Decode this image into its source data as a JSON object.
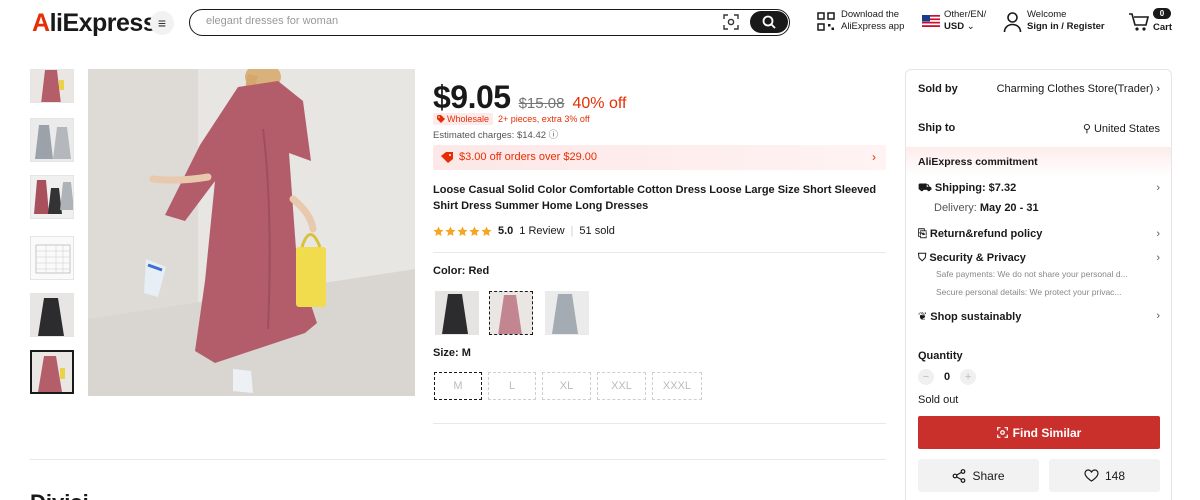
{
  "header": {
    "logo_part1": "A",
    "logo_part2": "liExpress",
    "search_placeholder": "elegant dresses for woman",
    "app_line1": "Download the",
    "app_line2": "AliExpress app",
    "locale_line1": "Other/EN/",
    "locale_line2": "USD",
    "user_line1": "Welcome",
    "user_line2": "Sign in / Register",
    "cart_count": "0",
    "cart_label": "Cart"
  },
  "product": {
    "price": "$9.05",
    "original_price": "$15.08",
    "discount": "40% off",
    "wholesale_badge": "Wholesale",
    "wholesale_text": "2+ pieces, extra 3% off",
    "estimated": "Estimated charges: $14.42",
    "coupon": "$3.00 off orders over $29.00",
    "title": "Loose Casual Solid Color Comfortable Cotton Dress Loose Large Size Short Sleeved Shirt Dress Summer Home Long Dresses",
    "rating": 5.0,
    "rating_text": "5.0",
    "reviews": "1 Review",
    "sold": "51 sold",
    "color_label": "Color: Red",
    "size_label": "Size: M",
    "sizes": [
      "M",
      "L",
      "XL",
      "XXL",
      "XXXL"
    ],
    "selected_size": "M",
    "colors": [
      "Black",
      "Red",
      "Gray"
    ],
    "selected_color": "Red"
  },
  "panel": {
    "sold_by_label": "Sold by",
    "sold_by_value": "Charming Clothes Store(Trader)",
    "ship_to_label": "Ship to",
    "ship_to_value": "United States",
    "commitment": "AliExpress commitment",
    "shipping": "Shipping: $7.32",
    "delivery_label": "Delivery:",
    "delivery_value": "May 20 - 31",
    "return_policy": "Return&refund policy",
    "security": "Security & Privacy",
    "security_line1": "Safe payments: We do not share your personal d...",
    "security_line2": "Secure personal details: We protect your privac...",
    "sustainably": "Shop sustainably",
    "quantity_label": "Quantity",
    "quantity_value": "0",
    "sold_out": "Sold out",
    "find_similar": "Find Similar",
    "share": "Share",
    "likes": "148"
  },
  "bottom": {
    "heading_fragment": "Divisi..."
  },
  "colors": {
    "brand_red": "#e62e04",
    "button_red": "#c9302c",
    "text": "#191919"
  }
}
